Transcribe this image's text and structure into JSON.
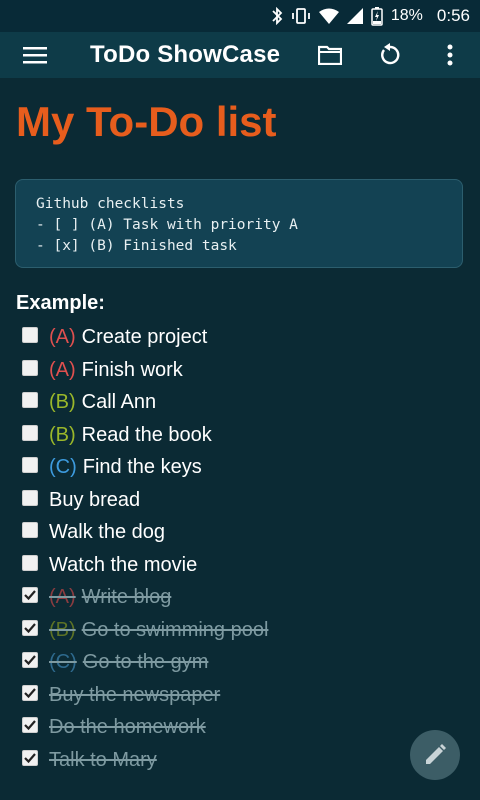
{
  "status_bar": {
    "battery": "18%",
    "time": "0:56",
    "icons": [
      "bluetooth-icon",
      "vibrate-icon",
      "wifi-icon",
      "cell-signal-icon",
      "battery-charging-icon"
    ]
  },
  "app_bar": {
    "title": "ToDo ShowCase",
    "menu_icon": "hamburger-menu-icon",
    "actions": [
      "folder-icon",
      "refresh-icon",
      "more-vert-icon"
    ]
  },
  "main": {
    "heading": "My To-Do list",
    "code_block": "Github checklists\n- [ ] (A) Task with priority A\n- [x] (B) Finished task",
    "example_label": "Example:",
    "items": [
      {
        "priority": "(A)",
        "priority_level": "A",
        "text": "Create project",
        "checked": false
      },
      {
        "priority": "(A)",
        "priority_level": "A",
        "text": "Finish work",
        "checked": false
      },
      {
        "priority": "(B)",
        "priority_level": "B",
        "text": "Call Ann",
        "checked": false
      },
      {
        "priority": "(B)",
        "priority_level": "B",
        "text": "Read the book",
        "checked": false
      },
      {
        "priority": "(C)",
        "priority_level": "C",
        "text": "Find the keys",
        "checked": false
      },
      {
        "priority": "",
        "priority_level": "",
        "text": "Buy bread",
        "checked": false
      },
      {
        "priority": "",
        "priority_level": "",
        "text": "Walk the dog",
        "checked": false
      },
      {
        "priority": "",
        "priority_level": "",
        "text": "Watch the movie",
        "checked": false
      },
      {
        "priority": "(A)",
        "priority_level": "A",
        "text": "Write blog",
        "checked": true
      },
      {
        "priority": "(B)",
        "priority_level": "B",
        "text": "Go to swimming pool",
        "checked": true
      },
      {
        "priority": "(C)",
        "priority_level": "C",
        "text": "Go to the gym",
        "checked": true
      },
      {
        "priority": "",
        "priority_level": "",
        "text": "Buy the newspaper",
        "checked": true
      },
      {
        "priority": "",
        "priority_level": "",
        "text": "Do the homework",
        "checked": true
      },
      {
        "priority": "",
        "priority_level": "",
        "text": "Talk to Mary",
        "checked": true
      }
    ]
  },
  "fab": {
    "icon": "pencil-edit-icon"
  },
  "colors": {
    "background": "#0b2a34",
    "app_bar": "#0e3b48",
    "heading": "#e75d1d",
    "priority_A": "#e0504f",
    "priority_B": "#9ab72a",
    "priority_C": "#3d9bde"
  }
}
